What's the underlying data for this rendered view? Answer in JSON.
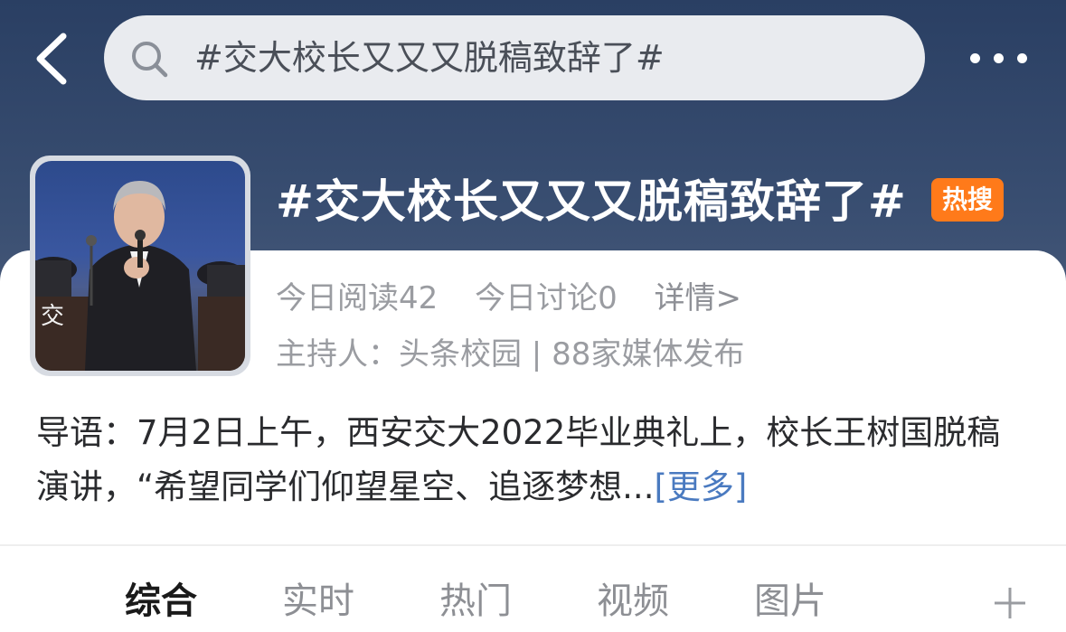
{
  "header": {
    "search_query": "#交大校长又又又脱稿致辞了#",
    "topic_title": "#交大校长又又又脱稿致辞了#",
    "hot_badge": "热搜"
  },
  "stats": {
    "today_reads": "今日阅读42",
    "today_discussions": "今日讨论0",
    "details": "详情>"
  },
  "host_line": "主持人：头条校园 | 88家媒体发布",
  "intro": {
    "text": "导语：7月2日上午，西安交大2022毕业典礼上，校长王树国脱稿演讲，“希望同学们仰望星空、追逐梦想...",
    "more": "[更多]"
  },
  "tabs": [
    {
      "label": "综合",
      "active": true
    },
    {
      "label": "实时",
      "active": false
    },
    {
      "label": "热门",
      "active": false
    },
    {
      "label": "视频",
      "active": false
    },
    {
      "label": "图片",
      "active": false
    }
  ],
  "icons": {
    "back": "back-chevron-icon",
    "search": "search-icon",
    "more": "more-dots-icon",
    "add": "plus-icon"
  },
  "colors": {
    "hot_badge": "#ff7a1a",
    "link": "#4a7ac0"
  }
}
